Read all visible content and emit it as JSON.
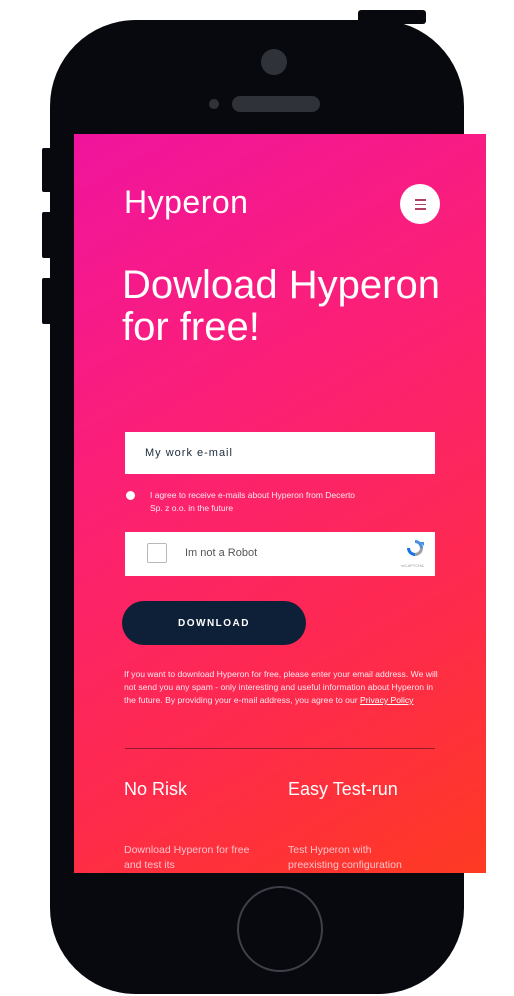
{
  "brand": "Hyperon",
  "headline": "Dowload Hyperon for free!",
  "form": {
    "email_placeholder": "My work e-mail",
    "consent_text": "I agree to receive e-mails about Hyperon from Decerto Sp. z o.o. in the future",
    "captcha_label": "Im not a Robot",
    "captcha_brand": "reCAPTCHA",
    "download_label": "DOWNLOAD"
  },
  "disclaimer": {
    "text": "If you want to download Hyperon for free, please enter your email address. We will not send you any spam - only interesting and useful information about Hyperon in the future. By providing your e-mail address, you agree to our ",
    "link": "Privacy Policy"
  },
  "features": [
    {
      "title": "No Risk",
      "text": "Download Hyperon for free and test its"
    },
    {
      "title": "Easy Test-run",
      "text": "Test Hyperon with preexisting configuration"
    }
  ],
  "icons": {
    "menu": "hamburger-menu-icon",
    "captcha": "recaptcha-logo-icon"
  },
  "colors": {
    "gradient_start": "#f0149e",
    "gradient_end": "#fe3a22",
    "button": "#0e1f38",
    "phone": "#07090f"
  }
}
